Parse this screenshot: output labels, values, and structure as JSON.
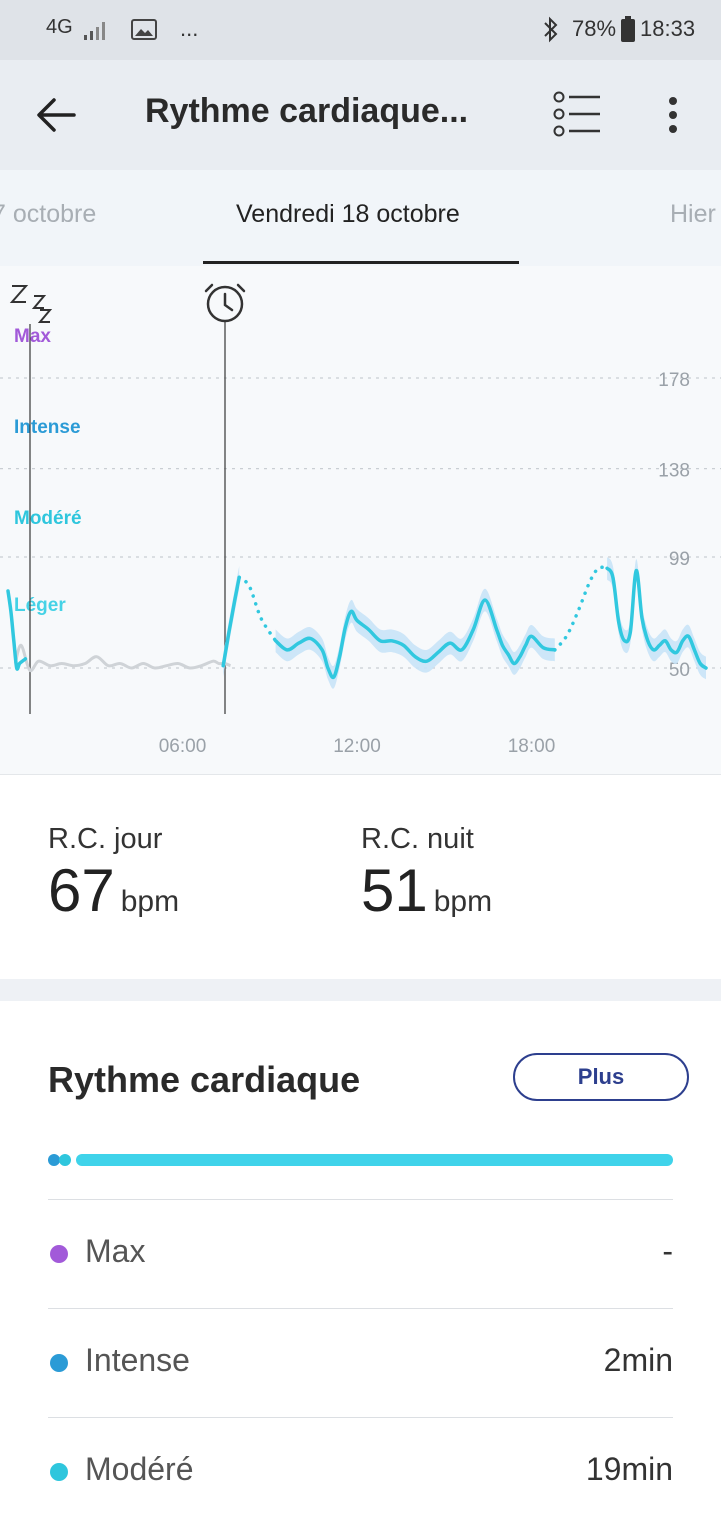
{
  "status_bar": {
    "network": "4G",
    "dots": "...",
    "battery": "78%",
    "time": "18:33"
  },
  "app_bar": {
    "title": "Rythme cardiaque..."
  },
  "tabs": {
    "prev": "7 octobre",
    "current": "Vendredi 18 octobre",
    "next": "Hier"
  },
  "chart_data": {
    "type": "line",
    "x_ticks": [
      "06:00",
      "12:00",
      "18:00"
    ],
    "y_ticks": [
      178,
      138,
      99,
      50
    ],
    "zones": [
      "Max",
      "Intense",
      "Modéré",
      "Léger"
    ],
    "zone_colors": [
      "#a25ad9",
      "#2b9bd6",
      "#2ec6dd",
      "#45d2e6"
    ],
    "ylim": [
      30,
      190
    ],
    "xlim_hours": [
      0,
      24
    ],
    "sleep_series": {
      "x": [
        0,
        0.2,
        0.5,
        0.8,
        1.2,
        1.6,
        2.0,
        2.4,
        2.8,
        3.2,
        3.6,
        4.0,
        4.4,
        4.8,
        5.2,
        5.6,
        6.0,
        6.4,
        6.8,
        7.0,
        7.2,
        7.4
      ],
      "y": [
        52,
        60,
        49,
        53,
        51,
        52,
        51,
        52,
        55,
        51,
        52,
        50,
        52,
        50,
        51,
        52,
        50,
        51,
        53,
        52,
        52,
        51
      ]
    },
    "wake_series": {
      "x": [
        0,
        0.1,
        0.2,
        0.3,
        0.4,
        0.6
      ],
      "y": [
        84,
        75,
        62,
        50,
        52,
        54
      ]
    },
    "series": [
      {
        "x": [
          7.4,
          7.6,
          7.8,
          7.95
        ],
        "y": [
          51,
          66,
          80,
          90
        ]
      },
      {
        "x": [
          9.2,
          9.6,
          10.0,
          10.4,
          10.8,
          11.0,
          11.2,
          11.4,
          11.6,
          11.8,
          12.0,
          12.4,
          12.8,
          13.2,
          13.6,
          14.0,
          14.4,
          14.8,
          15.2,
          15.6,
          16.0,
          16.4,
          16.8,
          17.0,
          17.2,
          17.4,
          17.6,
          17.8,
          18.0,
          18.4,
          18.8
        ],
        "y": [
          62,
          58,
          61,
          63,
          58,
          50,
          46,
          55,
          68,
          75,
          71,
          67,
          62,
          62,
          60,
          55,
          53,
          57,
          61,
          58,
          67,
          80,
          67,
          60,
          56,
          52,
          55,
          60,
          64,
          59,
          58
        ]
      },
      {
        "x": [
          20.6,
          20.8,
          21.0,
          21.2,
          21.4,
          21.6,
          21.8,
          22.0,
          22.2,
          22.4,
          22.6,
          22.8,
          23.0,
          23.2,
          23.4,
          23.6,
          23.8,
          24.0
        ],
        "y": [
          94,
          90,
          70,
          62,
          66,
          93,
          72,
          62,
          58,
          60,
          62,
          58,
          57,
          62,
          64,
          58,
          52,
          50
        ]
      }
    ],
    "dotted_gaps": [
      {
        "x": [
          7.95,
          8.3,
          8.7,
          9.2
        ],
        "y": [
          90,
          86,
          72,
          62
        ]
      },
      {
        "x": [
          18.8,
          19.2,
          19.6,
          20.0,
          20.3,
          20.6
        ],
        "y": [
          58,
          64,
          75,
          88,
          94,
          94
        ]
      }
    ]
  },
  "summary": {
    "day_label": "R.C. jour",
    "day_value": "67",
    "day_unit": "bpm",
    "night_label": "R.C. nuit",
    "night_value": "51",
    "night_unit": "bpm"
  },
  "zones_section": {
    "title": "Rythme cardiaque",
    "more_button": "Plus",
    "rows": [
      {
        "name": "Max",
        "value": "-",
        "color": "#a25ad9"
      },
      {
        "name": "Intense",
        "value": "2min",
        "color": "#2b9bd6"
      },
      {
        "name": "Modéré",
        "value": "19min",
        "color": "#2ec6dd"
      }
    ]
  }
}
